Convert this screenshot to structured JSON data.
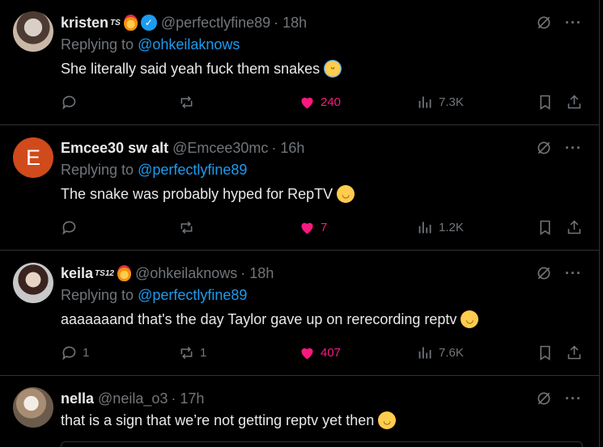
{
  "tweets": [
    {
      "name": "kristen",
      "name_sup": "TS",
      "handle": "@perfectlyfine89",
      "time": "· 18h",
      "replying_label": "Replying to",
      "replying_to": "@ohkeilaknows",
      "text": "She literally said yeah fuck them snakes",
      "replies": "",
      "reposts": "",
      "likes": "240",
      "views": "7.3K"
    },
    {
      "name": "Emcee30 sw alt",
      "avatar_letter": "E",
      "handle": "@Emcee30mc",
      "time": "· 16h",
      "replying_label": "Replying to",
      "replying_to": "@perfectlyfine89",
      "text": "The snake was probably hyped for RepTV",
      "replies": "",
      "reposts": "",
      "likes": "7",
      "views": "1.2K"
    },
    {
      "name": "keila",
      "name_sup": "TS12",
      "handle": "@ohkeilaknows",
      "time": "· 18h",
      "replying_label": "Replying to",
      "replying_to": "@perfectlyfine89",
      "text": "aaaaaaand that's the day Taylor gave up on rerecording reptv",
      "replies": "1",
      "reposts": "1",
      "likes": "407",
      "views": "7.6K"
    },
    {
      "name": "nella",
      "handle": "@neila_o3",
      "time": "· 17h",
      "text": "that is a sign that we’re not getting reptv yet then"
    }
  ],
  "colors": {
    "background": "#000000",
    "link": "#1d9bf0",
    "like": "#f91880",
    "muted": "#71767b"
  },
  "icons": [
    "reply-icon",
    "repost-icon",
    "heart-icon",
    "views-icon",
    "bookmark-icon",
    "share-icon",
    "grok-icon",
    "more-icon"
  ]
}
